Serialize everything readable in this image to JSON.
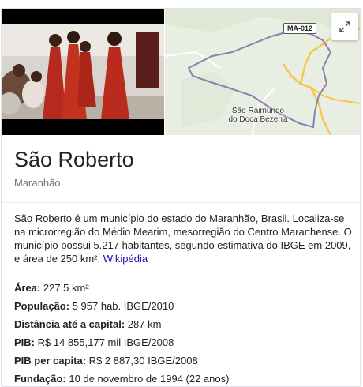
{
  "map": {
    "road_badge": "MA-012",
    "place_label": "São Raimundo do Doca Bezerra"
  },
  "header": {
    "title": "São Roberto",
    "subtitle": "Maranhão"
  },
  "description": {
    "text": "São Roberto é um município do estado do Maranhão, Brasil. Localiza-se na microrregião do Médio Mearim, mesorregião do Centro Maranhense. O município possui 5.217 habitantes, segundo estimativa do IBGE em 2009, e área de 250 km².",
    "source_link": "Wikipédia"
  },
  "facts": [
    {
      "label": "Área:",
      "value": "227,5 km²"
    },
    {
      "label": "População:",
      "value": "5 957 hab. IBGE/2010"
    },
    {
      "label": "Distância até a capital:",
      "value": "287 km"
    },
    {
      "label": "PIB:",
      "value": "R$ 14 855,177 mil IBGE/2008"
    },
    {
      "label": "PIB per capita:",
      "value": "R$ 2 887,30 IBGE/2008"
    },
    {
      "label": "Fundação:",
      "value": "10 de novembro de 1994 (22 anos)"
    }
  ],
  "colors": {
    "link": "#1a0dab",
    "boundary": "#8a7fb0",
    "road": "#f2c94c"
  }
}
